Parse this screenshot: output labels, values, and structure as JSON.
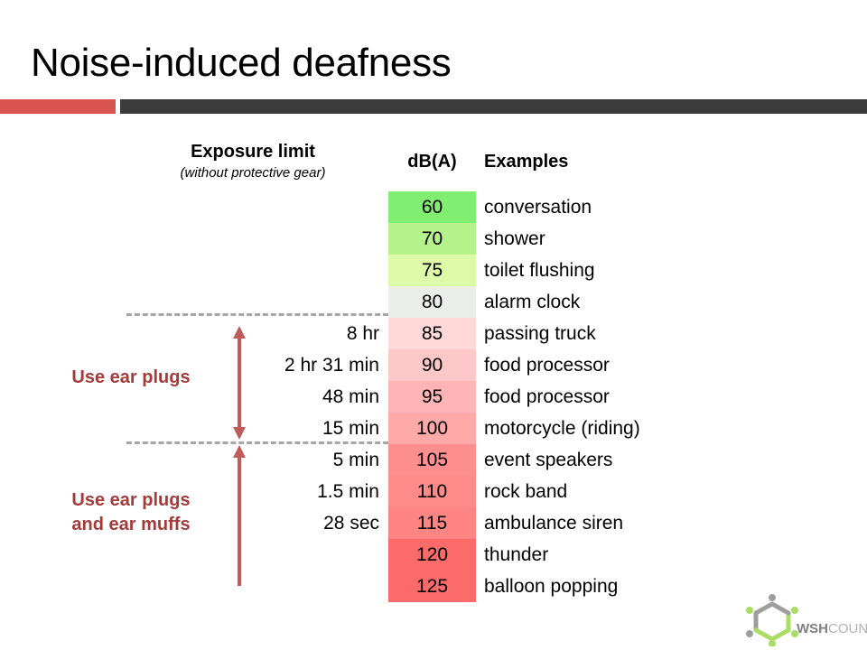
{
  "slide": {
    "title": "Noise-induced deafness",
    "accent_red": "#d9534f",
    "accent_dark": "#3b3b3b",
    "label_color": "#a33b3b"
  },
  "headers": {
    "exposure_main": "Exposure limit",
    "exposure_sub": "(without protective gear)",
    "db": "dB(A)",
    "examples": "Examples"
  },
  "rows": [
    {
      "exposure": "",
      "db": "60",
      "example": "conversation",
      "color": "#80ee70"
    },
    {
      "exposure": "",
      "db": "70",
      "example": "shower",
      "color": "#b5f28a"
    },
    {
      "exposure": "",
      "db": "75",
      "example": "toilet flushing",
      "color": "#ddfaa8"
    },
    {
      "exposure": "",
      "db": "80",
      "example": "alarm clock",
      "color": "#ebedea"
    },
    {
      "exposure": "8 hr",
      "db": "85",
      "example": "passing truck",
      "color": "#ffd8d8"
    },
    {
      "exposure": "2 hr 31 min",
      "db": "90",
      "example": "food processor",
      "color": "#ffc8c8"
    },
    {
      "exposure": "48 min",
      "db": "95",
      "example": "food processor",
      "color": "#ffb5b5"
    },
    {
      "exposure": "15 min",
      "db": "100",
      "example": "motorcycle (riding)",
      "color": "#ffa9a9"
    },
    {
      "exposure": "5 min",
      "db": "105",
      "example": "event speakers",
      "color": "#ff8f8f"
    },
    {
      "exposure": "1.5 min",
      "db": "110",
      "example": "rock band",
      "color": "#ff8a8a"
    },
    {
      "exposure": "28 sec",
      "db": "115",
      "example": "ambulance siren",
      "color": "#ff8585"
    },
    {
      "exposure": "",
      "db": "120",
      "example": "thunder",
      "color": "#fc6a6a"
    },
    {
      "exposure": "",
      "db": "125",
      "example": "balloon popping",
      "color": "#fc6a6a"
    }
  ],
  "annotations": {
    "use_ear_plugs": "Use ear plugs",
    "use_plugs_and_muffs_line1": "Use ear plugs",
    "use_plugs_and_muffs_line2": "and ear muffs"
  },
  "logo": {
    "name_bold": "WSH",
    "name_light": "COUNCIL"
  }
}
